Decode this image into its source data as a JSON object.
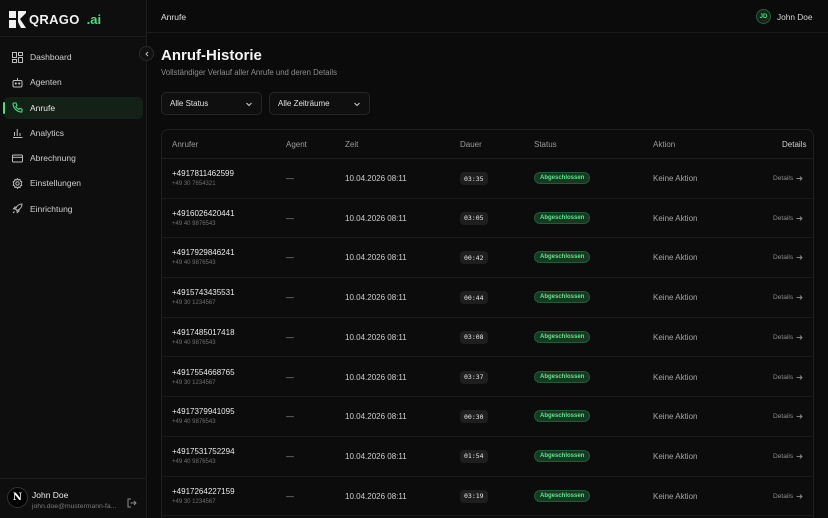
{
  "app": {
    "brand": "QRAGO",
    "brand_suffix": ".ai",
    "accent": "#4ade80"
  },
  "sidebar": {
    "items": [
      {
        "label": "Dashboard",
        "icon": "dashboard-icon",
        "active": false
      },
      {
        "label": "Agenten",
        "icon": "robot-icon",
        "active": false
      },
      {
        "label": "Anrufe",
        "icon": "phone-icon",
        "active": true
      },
      {
        "label": "Analytics",
        "icon": "bar-chart-icon",
        "active": false
      },
      {
        "label": "Abrechnung",
        "icon": "credit-card-icon",
        "active": false
      },
      {
        "label": "Einstellungen",
        "icon": "gear-icon",
        "active": false
      },
      {
        "label": "Einrichtung",
        "icon": "rocket-icon",
        "active": false
      }
    ],
    "user": {
      "avatar_letter": "N",
      "name": "John Doe",
      "email": "john.doe@mustermann-fa..."
    }
  },
  "topbar": {
    "breadcrumb": "Anrufe",
    "user_initials": "JD",
    "user_name": "John Doe"
  },
  "main": {
    "title": "Anruf-Historie",
    "subtitle": "Vollständiger Verlauf aller Anrufe und deren Details",
    "filters": {
      "status": "Alle Status",
      "period": "Alle Zeiträume"
    },
    "table": {
      "columns": [
        "Anrufer",
        "Agent",
        "Zeit",
        "Dauer",
        "Status",
        "Aktion",
        "Details"
      ],
      "details_label": "Details",
      "rows": [
        {
          "caller": "+4917811462599",
          "sub": "+49 30 7654321",
          "agent": "—",
          "time": "10.04.2026 08:11",
          "duration": "03:35",
          "status": "Abgeschlossen",
          "action": "Keine Aktion"
        },
        {
          "caller": "+4916026420441",
          "sub": "+49 40 9876543",
          "agent": "—",
          "time": "10.04.2026 08:11",
          "duration": "03:05",
          "status": "Abgeschlossen",
          "action": "Keine Aktion"
        },
        {
          "caller": "+4917929846241",
          "sub": "+49 40 9876543",
          "agent": "—",
          "time": "10.04.2026 08:11",
          "duration": "00:42",
          "status": "Abgeschlossen",
          "action": "Keine Aktion"
        },
        {
          "caller": "+4915743435531",
          "sub": "+49 30 1234567",
          "agent": "—",
          "time": "10.04.2026 08:11",
          "duration": "00:44",
          "status": "Abgeschlossen",
          "action": "Keine Aktion"
        },
        {
          "caller": "+4917485017418",
          "sub": "+49 40 9876543",
          "agent": "—",
          "time": "10.04.2026 08:11",
          "duration": "03:08",
          "status": "Abgeschlossen",
          "action": "Keine Aktion"
        },
        {
          "caller": "+4917554668765",
          "sub": "+49 30 1234567",
          "agent": "—",
          "time": "10.04.2026 08:11",
          "duration": "03:37",
          "status": "Abgeschlossen",
          "action": "Keine Aktion"
        },
        {
          "caller": "+4917379941095",
          "sub": "+49 40 9876543",
          "agent": "—",
          "time": "10.04.2026 08:11",
          "duration": "00:30",
          "status": "Abgeschlossen",
          "action": "Keine Aktion"
        },
        {
          "caller": "+4917531752294",
          "sub": "+49 40 9876543",
          "agent": "—",
          "time": "10.04.2026 08:11",
          "duration": "01:54",
          "status": "Abgeschlossen",
          "action": "Keine Aktion"
        },
        {
          "caller": "+4917264227159",
          "sub": "+49 30 1234567",
          "agent": "—",
          "time": "10.04.2026 08:11",
          "duration": "03:19",
          "status": "Abgeschlossen",
          "action": "Keine Aktion"
        }
      ]
    }
  }
}
